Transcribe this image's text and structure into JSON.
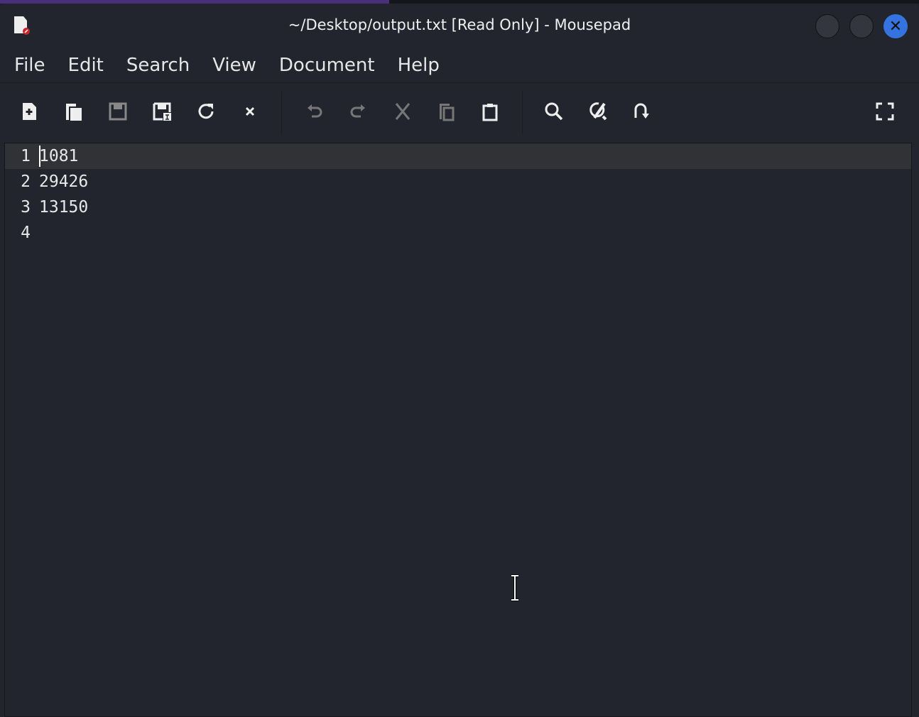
{
  "window": {
    "title": "~/Desktop/output.txt [Read Only] - Mousepad",
    "close_label": "✕"
  },
  "menu": [
    "File",
    "Edit",
    "Search",
    "View",
    "Document",
    "Help"
  ],
  "toolbar": [
    "new-document",
    "new-window",
    "save",
    "save-as",
    "reload",
    "close",
    "undo",
    "redo",
    "cut",
    "copy",
    "paste",
    "find",
    "find-replace",
    "go-to-line",
    "fullscreen"
  ],
  "editor": {
    "lines": [
      {
        "num": "1",
        "text": "1081"
      },
      {
        "num": "2",
        "text": "29426"
      },
      {
        "num": "3",
        "text": "13150"
      },
      {
        "num": "4",
        "text": ""
      }
    ]
  },
  "colors": {
    "close": "#3574e0",
    "bg": "#22252d",
    "current_line": "#303236"
  }
}
